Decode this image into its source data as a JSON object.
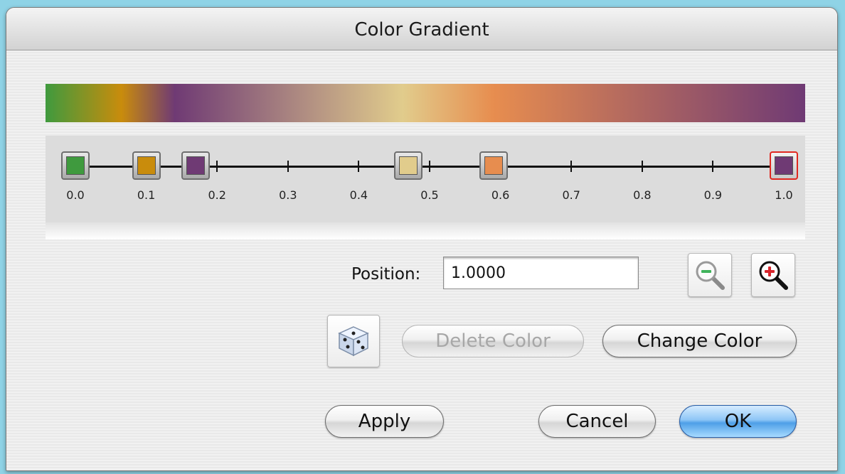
{
  "window": {
    "title": "Color Gradient"
  },
  "gradient": {
    "stops": [
      {
        "position": 0.0,
        "color": "#3f9a3e"
      },
      {
        "position": 0.1,
        "color": "#c98c0c"
      },
      {
        "position": 0.17,
        "color": "#6f3a74"
      },
      {
        "position": 0.47,
        "color": "#e1cc8c"
      },
      {
        "position": 0.59,
        "color": "#e78d4f"
      },
      {
        "position": 1.0,
        "color": "#6f3a74",
        "selected": true
      }
    ],
    "tick_labels": [
      "0.0",
      "0.1",
      "0.2",
      "0.3",
      "0.4",
      "0.5",
      "0.6",
      "0.7",
      "0.8",
      "0.9",
      "1.0"
    ]
  },
  "position": {
    "label": "Position:",
    "value": "1.0000"
  },
  "zoom": {
    "out_icon": "zoom-out-icon",
    "in_icon": "zoom-in-icon"
  },
  "random": {
    "icon": "dice-icon"
  },
  "buttons": {
    "delete_color": "Delete Color",
    "change_color": "Change Color",
    "apply": "Apply",
    "cancel": "Cancel",
    "ok": "OK"
  }
}
